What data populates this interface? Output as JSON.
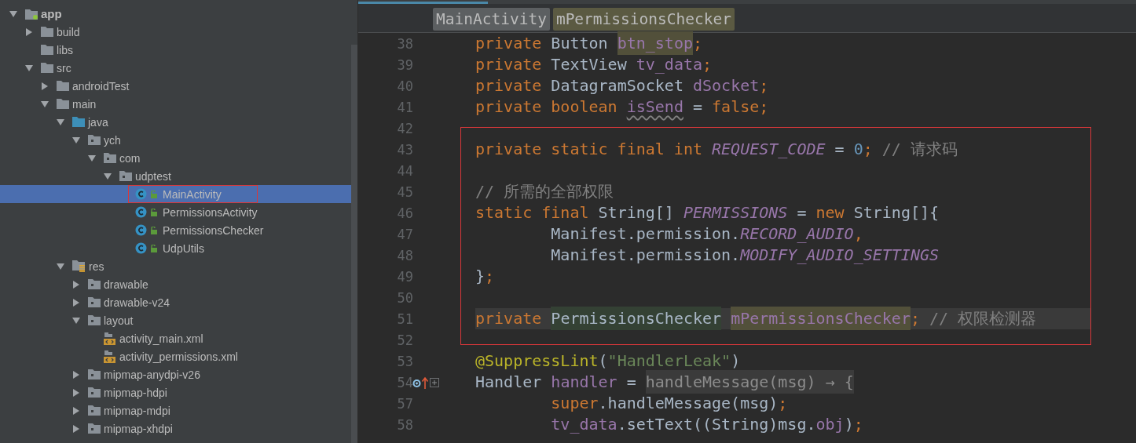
{
  "project_tree": {
    "items": [
      {
        "label": "app",
        "kind": "module",
        "expanded": true,
        "selected": false,
        "children": [
          {
            "label": "build",
            "kind": "folder",
            "expanded": false,
            "selected": false
          },
          {
            "label": "libs",
            "kind": "folder",
            "selected": false
          },
          {
            "label": "src",
            "kind": "folder",
            "expanded": true,
            "selected": false,
            "children": [
              {
                "label": "androidTest",
                "kind": "folder",
                "expanded": false,
                "selected": false
              },
              {
                "label": "main",
                "kind": "folder",
                "expanded": true,
                "selected": false,
                "children": [
                  {
                    "label": "java",
                    "kind": "source-root",
                    "expanded": true,
                    "selected": false,
                    "children": [
                      {
                        "label": "ych",
                        "kind": "package",
                        "expanded": true,
                        "selected": false,
                        "children": [
                          {
                            "label": "com",
                            "kind": "package",
                            "expanded": true,
                            "selected": false,
                            "children": [
                              {
                                "label": "udptest",
                                "kind": "package",
                                "expanded": true,
                                "selected": false,
                                "children": [
                                  {
                                    "label": "MainActivity",
                                    "kind": "class",
                                    "selected": true,
                                    "boxed": true
                                  },
                                  {
                                    "label": "PermissionsActivity",
                                    "kind": "class",
                                    "selected": false,
                                    "boxed": false
                                  },
                                  {
                                    "label": "PermissionsChecker",
                                    "kind": "class",
                                    "selected": false,
                                    "boxed": false
                                  },
                                  {
                                    "label": "UdpUtils",
                                    "kind": "class",
                                    "selected": false,
                                    "boxed": false
                                  }
                                ]
                              }
                            ]
                          }
                        ]
                      }
                    ]
                  },
                  {
                    "label": "res",
                    "kind": "res-root",
                    "expanded": true,
                    "selected": false,
                    "children": [
                      {
                        "label": "drawable",
                        "kind": "package",
                        "expanded": false,
                        "selected": false
                      },
                      {
                        "label": "drawable-v24",
                        "kind": "package",
                        "expanded": false,
                        "selected": false
                      },
                      {
                        "label": "layout",
                        "kind": "package",
                        "expanded": true,
                        "selected": false,
                        "children": [
                          {
                            "label": "activity_main.xml",
                            "kind": "layout-xml",
                            "selected": false
                          },
                          {
                            "label": "activity_permissions.xml",
                            "kind": "layout-xml",
                            "selected": false
                          }
                        ]
                      },
                      {
                        "label": "mipmap-anydpi-v26",
                        "kind": "package",
                        "expanded": false,
                        "selected": false
                      },
                      {
                        "label": "mipmap-hdpi",
                        "kind": "package",
                        "expanded": false,
                        "selected": false
                      },
                      {
                        "label": "mipmap-mdpi",
                        "kind": "package",
                        "expanded": false,
                        "selected": false
                      },
                      {
                        "label": "mipmap-xhdpi",
                        "kind": "package",
                        "expanded": false,
                        "selected": false
                      }
                    ]
                  }
                ]
              }
            ]
          }
        ]
      }
    ]
  },
  "breadcrumb": [
    {
      "label": "MainActivity",
      "kind": "class"
    },
    {
      "label": "mPermissionsChecker",
      "kind": "field"
    }
  ],
  "editor": {
    "sections": [
      {
        "boxed": false,
        "lines": [
          {
            "number": "38",
            "tokens": [
              {
                "text": "private ",
                "kind": "keyword"
              },
              {
                "text": "Button ",
                "kind": "plain"
              },
              {
                "text": "btn_stop",
                "kind": "field",
                "highlighted": true
              },
              {
                "text": ";",
                "kind": "keyword"
              }
            ]
          },
          {
            "number": "39",
            "tokens": [
              {
                "text": "private ",
                "kind": "keyword"
              },
              {
                "text": "TextView ",
                "kind": "plain"
              },
              {
                "text": "tv_data",
                "kind": "field"
              },
              {
                "text": ";",
                "kind": "keyword"
              }
            ]
          },
          {
            "number": "40",
            "tokens": [
              {
                "text": "private ",
                "kind": "keyword"
              },
              {
                "text": "DatagramSocket ",
                "kind": "plain"
              },
              {
                "text": "dSocket",
                "kind": "field"
              },
              {
                "text": ";",
                "kind": "keyword"
              }
            ]
          },
          {
            "number": "41",
            "tokens": [
              {
                "text": "private boolean ",
                "kind": "keyword"
              },
              {
                "text": "isSend",
                "kind": "field",
                "warning": true
              },
              {
                "text": " = ",
                "kind": "plain"
              },
              {
                "text": "false;",
                "kind": "keyword"
              }
            ]
          },
          {
            "number": "42"
          }
        ]
      },
      {
        "boxed": true,
        "lines": [
          {
            "number": "43",
            "tokens": [
              {
                "text": "private static final int ",
                "kind": "keyword"
              },
              {
                "text": "REQUEST_CODE",
                "kind": "static-field"
              },
              {
                "text": " = ",
                "kind": "plain"
              },
              {
                "text": "0",
                "kind": "number"
              },
              {
                "text": ";",
                "kind": "keyword"
              },
              {
                "text": " // 请求码",
                "kind": "comment"
              }
            ]
          },
          {
            "number": "44"
          },
          {
            "number": "45",
            "tokens": [
              {
                "text": "// 所需的全部权限",
                "kind": "comment"
              }
            ]
          },
          {
            "number": "46",
            "tokens": [
              {
                "text": "static final ",
                "kind": "keyword"
              },
              {
                "text": "String[] ",
                "kind": "plain"
              },
              {
                "text": "PERMISSIONS",
                "kind": "static-field"
              },
              {
                "text": " = ",
                "kind": "plain"
              },
              {
                "text": "new ",
                "kind": "keyword"
              },
              {
                "text": "String[]{",
                "kind": "plain"
              }
            ]
          },
          {
            "number": "47",
            "tokens": [
              {
                "text": "        Manifest.permission.",
                "kind": "plain"
              },
              {
                "text": "RECORD_AUDIO",
                "kind": "static-field"
              },
              {
                "text": ",",
                "kind": "keyword"
              }
            ]
          },
          {
            "number": "48",
            "tokens": [
              {
                "text": "        Manifest.permission.",
                "kind": "plain"
              },
              {
                "text": "MODIFY_AUDIO_SETTINGS",
                "kind": "static-field"
              }
            ]
          },
          {
            "number": "49",
            "tokens": [
              {
                "text": "}",
                "kind": "plain"
              },
              {
                "text": ";",
                "kind": "keyword"
              }
            ]
          },
          {
            "number": "50"
          },
          {
            "number": "51",
            "current": true,
            "tokens": [
              {
                "text": "private ",
                "kind": "keyword"
              },
              {
                "text": "PermissionsChecker ",
                "kind": "type",
                "highlighted": true
              },
              {
                "text": "mPermissionsChecker",
                "kind": "field",
                "highlighted": true
              },
              {
                "text": ";",
                "kind": "keyword"
              },
              {
                "text": " // 权限检测器",
                "kind": "comment"
              }
            ]
          },
          {
            "number": "52"
          }
        ]
      },
      {
        "boxed": false,
        "lines": [
          {
            "number": "53",
            "tokens": [
              {
                "text": "@SuppressLint",
                "kind": "annotation"
              },
              {
                "text": "(",
                "kind": "plain"
              },
              {
                "text": "\"HandlerLeak\"",
                "kind": "string"
              },
              {
                "text": ")",
                "kind": "plain"
              }
            ]
          },
          {
            "number": "54",
            "overridden": true,
            "folded": true,
            "tokens": [
              {
                "text": "Handler ",
                "kind": "plain"
              },
              {
                "text": "handler",
                "kind": "field"
              },
              {
                "text": " = ",
                "kind": "plain"
              },
              {
                "text": "handleMessage(msg) → {",
                "kind": "folded"
              }
            ]
          },
          {
            "number": "57",
            "tokens": [
              {
                "text": "        super",
                "kind": "keyword"
              },
              {
                "text": ".handleMessage(msg)",
                "kind": "plain"
              },
              {
                "text": ";",
                "kind": "keyword"
              }
            ]
          },
          {
            "number": "58",
            "tokens": [
              {
                "text": "        tv_data",
                "kind": "field"
              },
              {
                "text": ".setText((String)msg.",
                "kind": "plain"
              },
              {
                "text": "obj",
                "kind": "field"
              },
              {
                "text": ")",
                "kind": "plain"
              },
              {
                "text": ";",
                "kind": "keyword"
              }
            ]
          }
        ]
      }
    ]
  }
}
